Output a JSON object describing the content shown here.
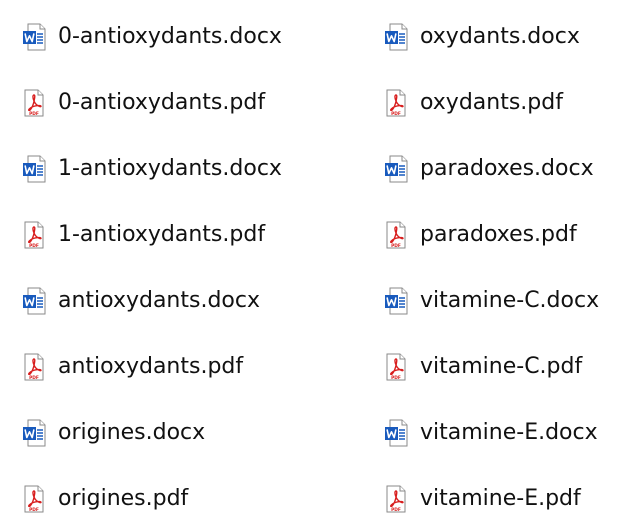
{
  "colors": {
    "word_blue": "#185abd",
    "pdf_red": "#d81e1e",
    "page_border": "#8a8a8a",
    "text": "#111111"
  },
  "files": {
    "left": [
      {
        "name": "0-antioxydants.docx",
        "icon": "word-document-icon"
      },
      {
        "name": "0-antioxydants.pdf",
        "icon": "pdf-document-icon"
      },
      {
        "name": "1-antioxydants.docx",
        "icon": "word-document-icon"
      },
      {
        "name": "1-antioxydants.pdf",
        "icon": "pdf-document-icon"
      },
      {
        "name": "antioxydants.docx",
        "icon": "word-document-icon"
      },
      {
        "name": "antioxydants.pdf",
        "icon": "pdf-document-icon"
      },
      {
        "name": "origines.docx",
        "icon": "word-document-icon"
      },
      {
        "name": "origines.pdf",
        "icon": "pdf-document-icon"
      }
    ],
    "right": [
      {
        "name": "oxydants.docx",
        "icon": "word-document-icon"
      },
      {
        "name": "oxydants.pdf",
        "icon": "pdf-document-icon"
      },
      {
        "name": "paradoxes.docx",
        "icon": "word-document-icon"
      },
      {
        "name": "paradoxes.pdf",
        "icon": "pdf-document-icon"
      },
      {
        "name": "vitamine-C.docx",
        "icon": "word-document-icon"
      },
      {
        "name": "vitamine-C.pdf",
        "icon": "pdf-document-icon"
      },
      {
        "name": "vitamine-E.docx",
        "icon": "word-document-icon"
      },
      {
        "name": "vitamine-E.pdf",
        "icon": "pdf-document-icon"
      }
    ]
  }
}
